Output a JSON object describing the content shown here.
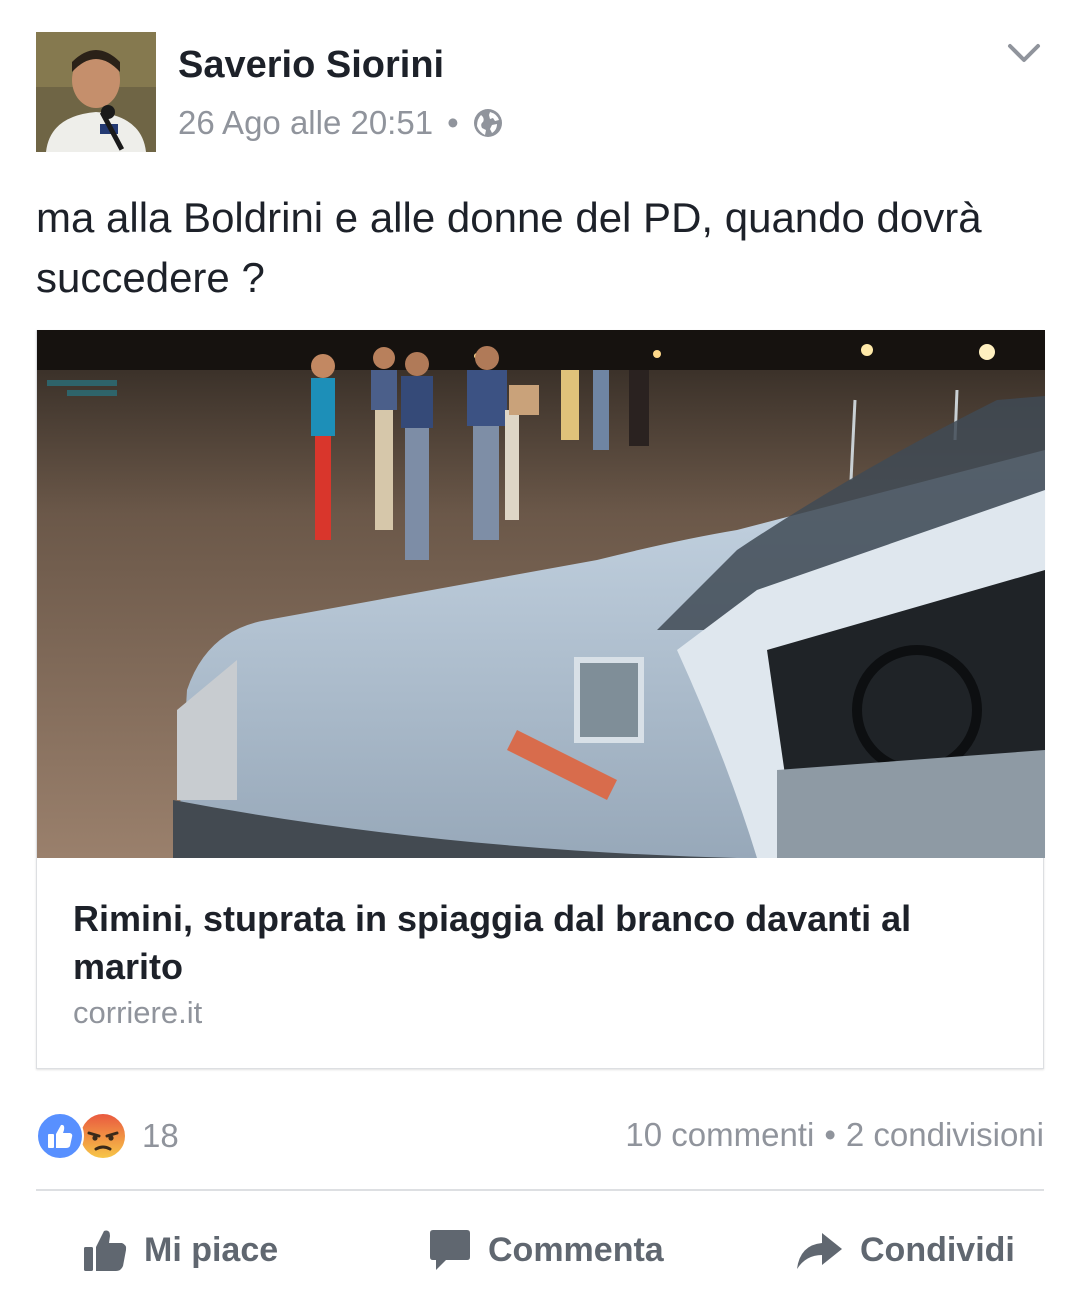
{
  "post": {
    "author": "Saverio Siorini",
    "timestamp": "26 Ago alle 20:51",
    "separator": "•",
    "privacy_icon": "globe-icon",
    "menu_icon": "chevron-down-icon",
    "text": "ma alla Boldrini e alle donne del PD, quando dovrà succedere ?"
  },
  "link": {
    "image_icon": "car-on-beach-photo",
    "title": "Rimini, stuprata in spiaggia dal branco davanti al marito",
    "domain": "corriere.it"
  },
  "engagement": {
    "reactions": [
      "like-icon",
      "angry-icon"
    ],
    "reaction_count": "18",
    "comments": "10 commenti",
    "separator": "•",
    "shares": "2 condivisioni"
  },
  "actions": {
    "like_label": "Mi piace",
    "comment_label": "Commenta",
    "share_label": "Condividi"
  },
  "colors": {
    "text": "#1d2129",
    "secondary": "#90949c",
    "action": "#606770",
    "like_blue": "#5890ff",
    "angry_red": "#e9573f"
  }
}
